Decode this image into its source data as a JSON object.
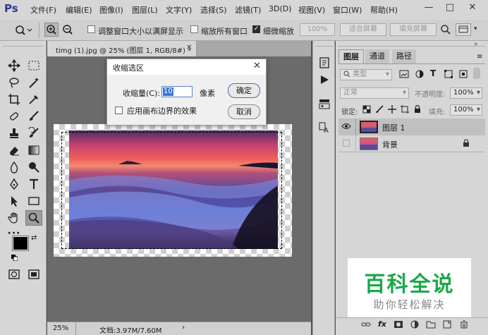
{
  "menu": {
    "logo": "Ps",
    "items": [
      "文件(F)",
      "编辑(E)",
      "图像(I)",
      "图层(L)",
      "文字(Y)",
      "选择(S)",
      "滤镜(T)",
      "3D(D)",
      "视图(V)",
      "窗口(W)",
      "帮助(H)"
    ],
    "window_controls": {
      "minimize": "—",
      "maximize": "□",
      "close": "✕"
    }
  },
  "options_bar": {
    "resize_windows_label": "调整窗口大小以满屏显示",
    "zoom_all_label": "缩放所有窗口",
    "scrubby_zoom_label": "细微缩放",
    "scrubby_zoom_checked": true,
    "btn_100": "100%",
    "btn_fit": "适合屏幕",
    "btn_fill": "填充屏幕"
  },
  "document": {
    "tab_title": "timg (1).jpg @ 25% (图层 1, RGB/8#) *",
    "zoom": "25%",
    "doc_info": "文档:3.97M/7.60M"
  },
  "dialog": {
    "title": "收缩选区",
    "contract_label": "收缩量(C):",
    "contract_value": "10",
    "unit": "像素",
    "apply_canvas_label": "应用画布边界的效果",
    "ok_label": "确定",
    "cancel_label": "取消"
  },
  "layers_panel": {
    "tabs": [
      "图层",
      "通道",
      "路径"
    ],
    "filter_kind": "类型",
    "blend_mode": "正常",
    "opacity_label": "不透明度:",
    "opacity_value": "100%",
    "lock_label": "锁定:",
    "fill_label": "填充:",
    "fill_value": "100%",
    "layers": [
      {
        "name": "图层 1",
        "visible": true,
        "selected": true
      },
      {
        "name": "背景",
        "visible": false,
        "selected": false,
        "locked": true
      }
    ],
    "footer_icons": [
      "link-icon",
      "fx-icon",
      "mask-icon",
      "adjustment-icon",
      "group-icon",
      "new-layer-icon",
      "trash-icon"
    ]
  },
  "watermark": {
    "title": "百科全说",
    "subtitle": "助你轻松解决"
  },
  "colors": {
    "accent_blue": "#2b3a8f",
    "watermark_green": "#1aa84a"
  }
}
